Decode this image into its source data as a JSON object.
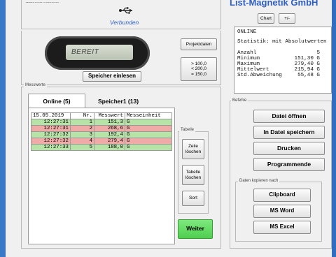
{
  "header": {
    "cut_label": "Datenschnittstelle",
    "connection_status": "Verbunden",
    "company_title": "List-Magnetik GmbH",
    "chart_button": "Chart",
    "plusminus_button": "+/-"
  },
  "device": {
    "display_text": "BEREIT",
    "read_button": "Speicher einlesen",
    "projektdaten_button": "Projektdaten",
    "range_line1": "> 100,0",
    "range_line2": "< 200,0",
    "range_line3": "= 150,0"
  },
  "info": {
    "status": "ONLINE",
    "stats_title": "Statistik:  mit Absolutwerten",
    "rows": [
      {
        "label": "Anzahl",
        "value": "5"
      },
      {
        "label": "Minimum",
        "value": "151,30 G"
      },
      {
        "label": "Maximum",
        "value": "279,40 G"
      },
      {
        "label": "Mittelwert",
        "value": "215,94 G"
      },
      {
        "label": "Std.Abweichung",
        "value": "55,48 G"
      }
    ]
  },
  "messwerte": {
    "group_label": "Messwerte",
    "tab_online": "Online (5)",
    "tab_speicher": "Speicher1 (13)",
    "header": {
      "date": "15.05.2019",
      "nr": "Nr.",
      "messwert": "Messwert",
      "einheit": "Messeinheit"
    },
    "rows": [
      {
        "time": "12:27:31",
        "nr": "1",
        "value": "151,3",
        "unit": "G",
        "status": "green"
      },
      {
        "time": "12:27:31",
        "nr": "2",
        "value": "268,6",
        "unit": "G",
        "status": "red"
      },
      {
        "time": "12:27:32",
        "nr": "3",
        "value": "192,4",
        "unit": "G",
        "status": "green"
      },
      {
        "time": "12:27:32",
        "nr": "4",
        "value": "279,4",
        "unit": "G",
        "status": "red"
      },
      {
        "time": "12:27:33",
        "nr": "5",
        "value": "188,0",
        "unit": "G",
        "status": "green"
      }
    ]
  },
  "tabelle": {
    "group_label": "Tabelle",
    "zeile_loeschen": "Zeile löschen",
    "tabelle_loeschen": "Tabelle löschen",
    "sort": "Sort",
    "weiter": "Weiter"
  },
  "befehle": {
    "group_label": "Befehle",
    "datei_oeffnen": "Datei öffnen",
    "in_datei_speichern": "In Datei speichern",
    "drucken": "Drucken",
    "programmende": "Programmende",
    "export_label": "Daten kopieren nach",
    "clipboard": "Clipboard",
    "ms_word": "MS Word",
    "ms_excel": "MS Excel"
  },
  "colors": {
    "accent_blue": "#2f5fc0",
    "row_ok": "#b6e3a6",
    "row_fail": "#f0aaa8",
    "weiter_green": "#5cd65c"
  }
}
